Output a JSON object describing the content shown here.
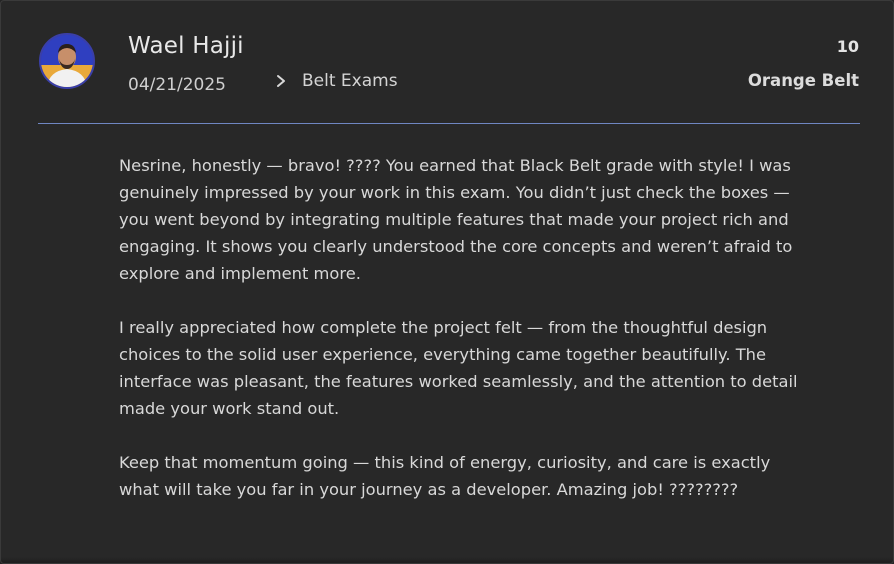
{
  "review": {
    "author_name": "Wael Hajji",
    "date": "04/21/2025",
    "category": "Belt Exams",
    "score": "10",
    "belt": "Orange Belt",
    "paragraphs": [
      "Nesrine, honestly — bravo! ???? You earned that Black Belt grade with style! I was genuinely impressed by your work in this exam. You didn’t just check the boxes — you went beyond by integrating multiple features that made your project rich and engaging. It shows you clearly understood the core concepts and weren’t afraid to explore and implement more.",
      "I really appreciated how complete the project felt — from the thoughtful design choices to the solid user experience, everything came together beautifully. The interface was pleasant, the features worked seamlessly, and the attention to detail made your work stand out.",
      "Keep that momentum going — this kind of energy, curiosity, and care is exactly what will take you far in your journey as a developer. Amazing job! ????????"
    ]
  },
  "colors": {
    "card_background": "#282828",
    "divider": "#6f86c2",
    "avatar_ring": "#3a3fa8"
  },
  "icons": {
    "avatar": "user-avatar-photo",
    "separator": "chevron-right-icon"
  }
}
